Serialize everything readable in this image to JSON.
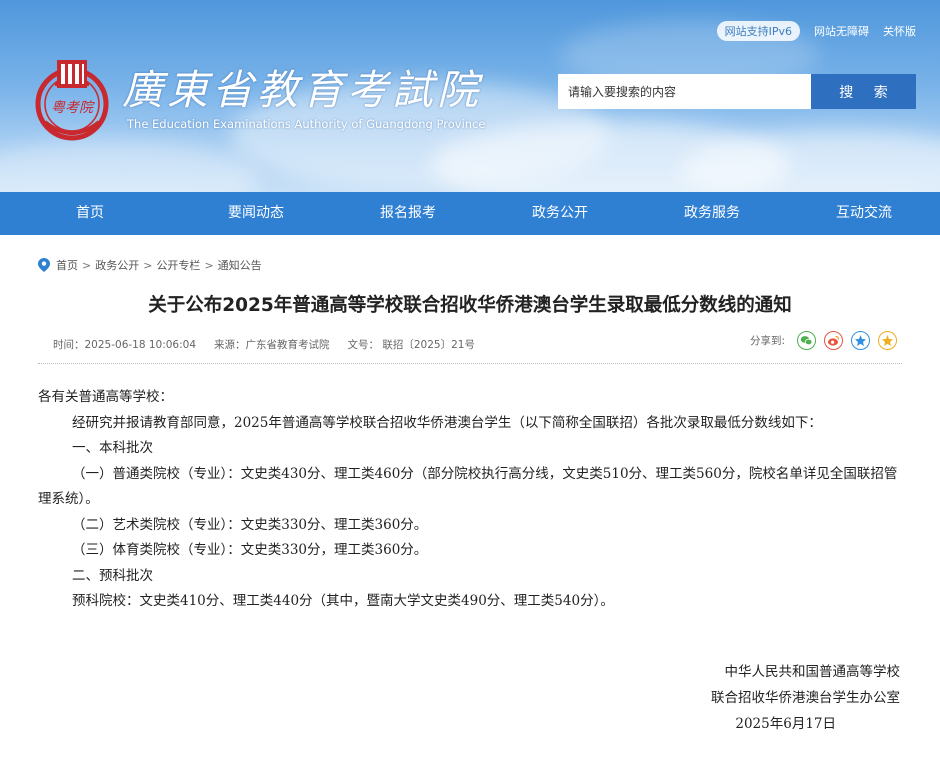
{
  "header": {
    "top_links": {
      "ipv6": "网站支持IPv6",
      "accessibility": "网站无障碍",
      "elder": "关怀版"
    },
    "emblem_text": "粤考院",
    "title": "廣東省教育考試院",
    "subtitle": "The Education Examinations Authority of Guangdong Province",
    "search": {
      "placeholder": "请输入要搜索的内容",
      "button": "搜 索"
    }
  },
  "nav": {
    "items": [
      "首页",
      "要闻动态",
      "报名报考",
      "政务公开",
      "政务服务",
      "互动交流"
    ]
  },
  "breadcrumb": [
    "首页",
    "政务公开",
    "公开专栏",
    "通知公告"
  ],
  "article": {
    "title": "关于公布2025年普通高等学校联合招收华侨港澳台学生录取最低分数线的通知",
    "meta": {
      "time": "时间：2025-06-18 10:06:04",
      "source": "来源：广东省教育考试院",
      "doc_no": "文号：  联招〔2025〕21号"
    },
    "share_label": "分享到:",
    "share_icons": [
      "wechat-icon",
      "weibo-icon",
      "qzone-icon",
      "favorite-icon"
    ],
    "paragraphs": [
      "各有关普通高等学校：",
      "经研究并报请教育部同意，2025年普通高等学校联合招收华侨港澳台学生（以下简称全国联招）各批次录取最低分数线如下：",
      "一、本科批次",
      "（一）普通类院校（专业）：文史类430分、理工类460分（部分院校执行高分线，文史类510分、理工类560分，院校名单详见全国联招管理系统）。",
      "（二）艺术类院校（专业）：文史类330分、理工类360分。",
      "（三）体育类院校（专业）：文史类330分，理工类360分。",
      "二、预科批次",
      "预科院校：文史类410分、理工类440分（其中，暨南大学文史类490分、理工类540分）。"
    ],
    "signature": {
      "line1": "中华人民共和国普通高等学校",
      "line2": "联合招收华侨港澳台学生办公室",
      "date": "2025年6月17日"
    }
  },
  "colors": {
    "nav_bg": "#2f7fd3",
    "search_button": "#2f6fc0",
    "emblem_red": "#c8282e"
  }
}
